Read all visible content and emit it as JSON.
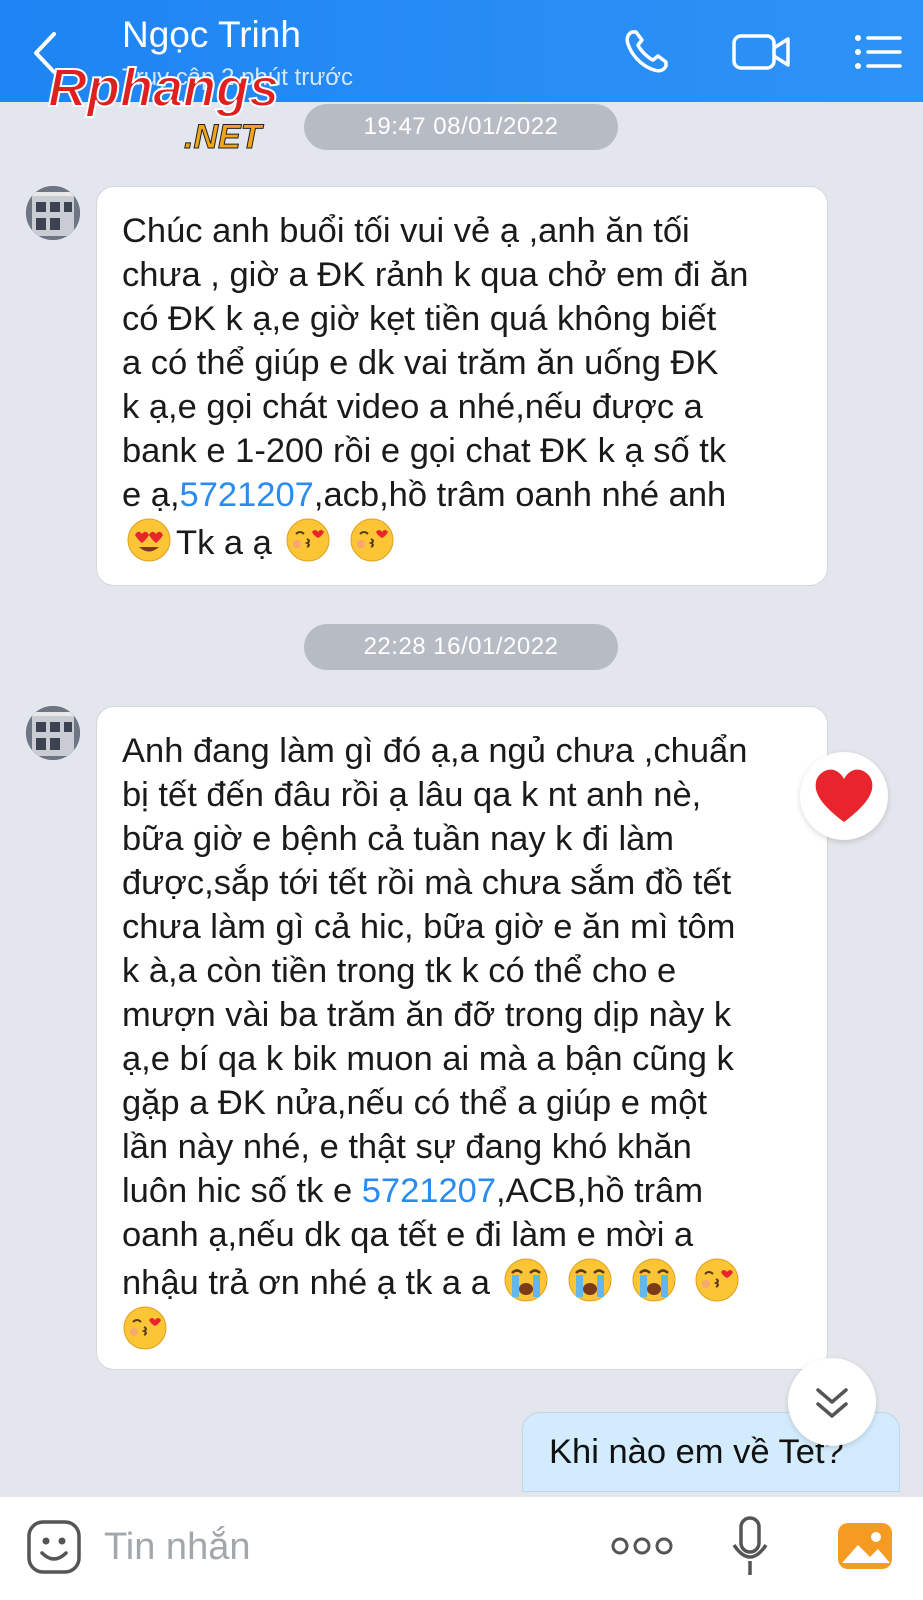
{
  "header": {
    "contact_name": "Ngọc Trinh",
    "status": "Truy cập 2 phút trước",
    "bg_color": "#2a8ef5"
  },
  "watermark": {
    "brand": "Rphangs",
    "suffix": ".NET"
  },
  "messages": [
    {
      "timestamp": "19:47 08/01/2022",
      "lines": [
        [
          "Chúc anh buổi tối vui vẻ ạ ,anh ăn tối"
        ],
        [
          "chưa , giờ a ĐK rảnh k qua chở em đi ăn"
        ],
        [
          "có ĐK k ạ,e giờ kẹt tiền quá không biết"
        ],
        [
          "a có thể giúp e dk vai trăm ăn uống ĐK"
        ],
        [
          "k ạ,e gọi chát video a nhé,nếu được a"
        ],
        [
          "bank e 1-200 rồi e gọi chat ĐK k ạ số tk"
        ]
      ],
      "line7_prefix": "e ạ,",
      "account_number": "5721207",
      "line7_suffix": ",acb,hồ trâm oanh nhé anh",
      "line8_text": "Tk a ạ"
    },
    {
      "timestamp": "22:28 16/01/2022",
      "lines": [
        "Anh đang làm gì đó ạ,a ngủ chưa ,chuẩn",
        "bị tết đến đâu rồi ạ lâu qa k nt anh nè,",
        "bữa giờ e bệnh cả tuần nay k đi làm",
        "được,sắp tới tết rồi mà chưa sắm đồ tết",
        "chưa làm gì cả hic, bữa giờ e ăn mì tôm",
        "k à,a còn tiền trong tk k có thể cho e",
        "mượn vài ba trăm ăn đỡ trong dịp này k",
        "ạ,e bí qa k bik muon ai mà a bận cũng k",
        "gặp a ĐK nửa,nếu có thể a giúp e một",
        "lần này nhé, e thật sự đang khó khăn"
      ],
      "line11_prefix": "luôn hic số tk e ",
      "account_number": "5721207",
      "line11_suffix": ",ACB,hồ trâm",
      "line12": "oanh ạ,nếu dk qa tết e đi làm e mời a",
      "line13": "nhậu trả ơn nhé ạ tk a a"
    }
  ],
  "sent_message": "Khi nào em về Tet?",
  "input": {
    "placeholder": "Tin nhắn"
  },
  "icons": {
    "back": "chevron-left-icon",
    "call": "phone-icon",
    "video": "video-camera-icon",
    "menu": "list-menu-icon",
    "reaction": "heart-icon",
    "scroll_down": "double-chevron-down-icon",
    "sticker": "smiley-icon",
    "more": "three-dots-icon",
    "mic": "microphone-icon",
    "photo": "image-icon"
  },
  "colors": {
    "link": "#2a8cf0",
    "heart": "#e8252c",
    "photo_icon": "#f59a22"
  }
}
